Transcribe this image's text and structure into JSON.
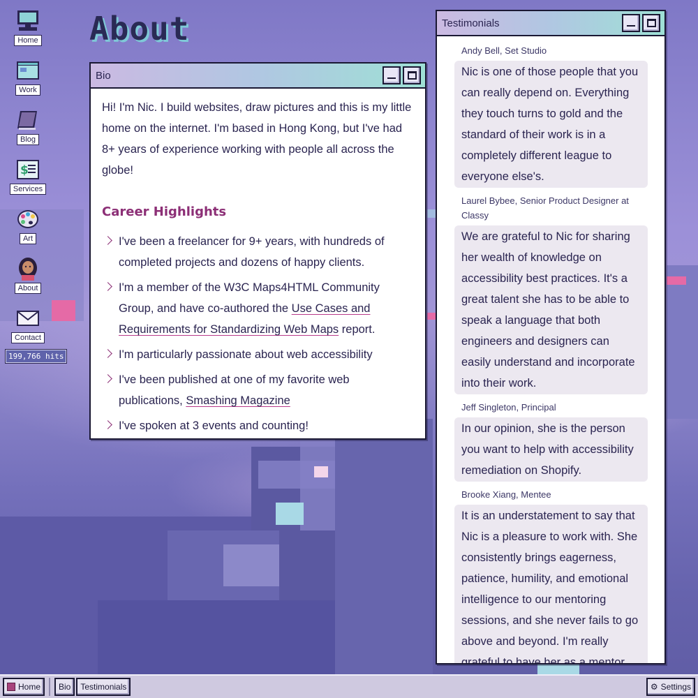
{
  "desktop": {
    "title": "About",
    "icons": [
      {
        "label": "Home",
        "icon": "computer-icon"
      },
      {
        "label": "Work",
        "icon": "window-icon"
      },
      {
        "label": "Blog",
        "icon": "notebook-icon"
      },
      {
        "label": "Services",
        "icon": "dollar-document-icon"
      },
      {
        "label": "Art",
        "icon": "palette-icon"
      },
      {
        "label": "About",
        "icon": "avatar-icon"
      },
      {
        "label": "Contact",
        "icon": "envelope-icon"
      }
    ],
    "hits": "199,766 hits"
  },
  "bio_window": {
    "title": "Bio",
    "intro": "Hi! I'm Nic. I build websites, draw pictures and this is my little home on the internet. I'm based in Hong Kong, but I've had 8+ years of experience working with people all across the globe!",
    "career_heading": "Career Highlights",
    "highlights": {
      "h1": "I've been a freelancer for 9+ years, with hundreds of completed projects and dozens of happy clients.",
      "h2_before": "I'm a member of the W3C Maps4HTML Community Group, and have co-authored the ",
      "h2_link": "Use Cases and Requirements for Standardizing Web Maps",
      "h2_after": " report.",
      "h3": "I'm particularly passionate about web accessibility",
      "h4_before": "I've been published at one of my favorite web publications, ",
      "h4_link": "Smashing Magazine",
      "h5": "I've spoken at 3 events and counting!"
    }
  },
  "testimonials_window": {
    "title": "Testimonials",
    "items": [
      {
        "author": "Andy Bell, Set Studio",
        "quote": "Nic is one of those people that you can really depend on. Everything they touch turns to gold and the standard of their work is in a completely different league to everyone else's."
      },
      {
        "author": "Laurel Bybee, Senior Product Designer at Classy",
        "quote": "We are grateful to Nic for sharing her wealth of knowledge on accessibility best practices. It's a great talent she has to be able to speak a language that both engineers and designers can easily understand and incorporate into their work."
      },
      {
        "author": "Jeff Singleton, Principal",
        "quote": "In our opinion, she is the person you want to help with accessibility remediation on Shopify."
      },
      {
        "author": "Brooke Xiang, Mentee",
        "quote": "It is an understatement to say that Nic is a pleasure to work with. She consistently brings eagerness, patience, humility, and emotional intelligence to our mentoring sessions, and she never fails to go above and beyond. I'm really grateful to have her as a mentor."
      }
    ]
  },
  "taskbar": {
    "home": "Home",
    "bio": "Bio",
    "testimonials": "Testimonials",
    "settings": "Settings"
  }
}
